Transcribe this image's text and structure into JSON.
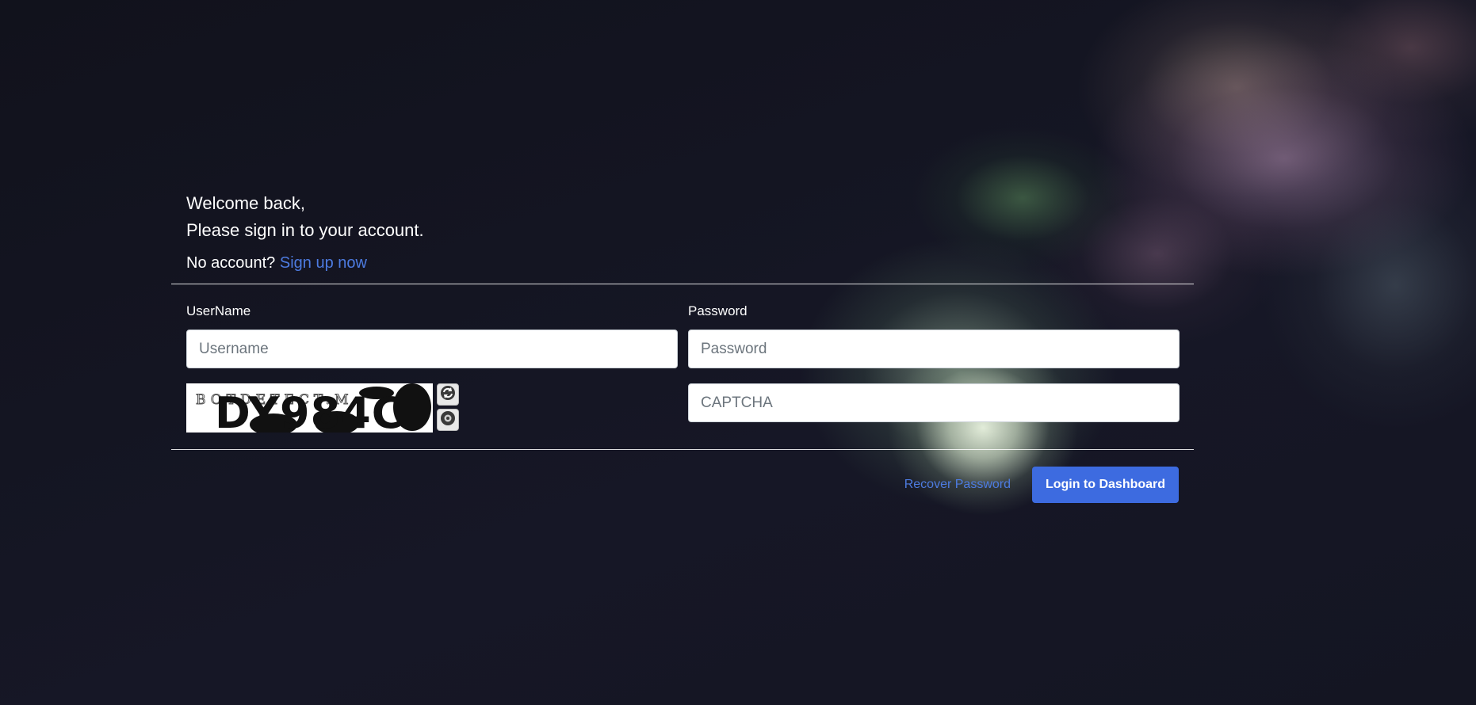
{
  "welcome": {
    "line1": "Welcome back,",
    "line2": "Please sign in to your account."
  },
  "signup": {
    "prompt": "No account?",
    "link": "Sign up now"
  },
  "fields": {
    "username_label": "UserName",
    "username_placeholder": "Username",
    "password_label": "Password",
    "password_placeholder": "Password",
    "captcha_placeholder": "CAPTCHA"
  },
  "captcha": {
    "text": "DY984C",
    "watermark": "BOTDETECT.M",
    "refresh_icon": "refresh-icon",
    "audio_icon": "speaker-icon"
  },
  "actions": {
    "recover_label": "Recover Password",
    "login_label": "Login to Dashboard"
  },
  "colors": {
    "accent": "#3d6be0",
    "link": "#4d7be0",
    "background": "#13141f"
  }
}
